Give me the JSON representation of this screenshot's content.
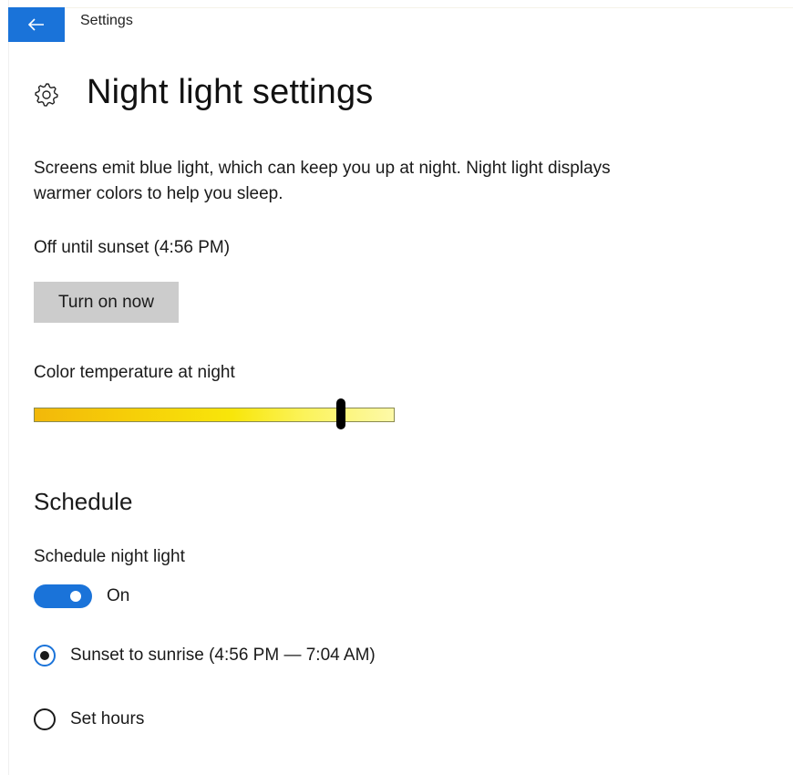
{
  "app": {
    "title": "Settings",
    "back_icon": "back-arrow-icon"
  },
  "header": {
    "icon": "gear-icon",
    "title": "Night light settings"
  },
  "description": "Screens emit blue light, which can keep you up at night. Night light displays warmer colors to help you sleep.",
  "status": "Off until sunset (4:56 PM)",
  "turn_on_button": "Turn on now",
  "color_temperature": {
    "label": "Color temperature at night",
    "value": 0.85
  },
  "schedule": {
    "heading": "Schedule",
    "label": "Schedule night light",
    "toggle_on": true,
    "toggle_state": "On",
    "options": [
      {
        "label": "Sunset to sunrise (4:56 PM — 7:04 AM)",
        "selected": true
      },
      {
        "label": "Set hours",
        "selected": false
      }
    ]
  },
  "colors": {
    "accent": "#1a73d9",
    "button_gray": "#cccccc"
  }
}
